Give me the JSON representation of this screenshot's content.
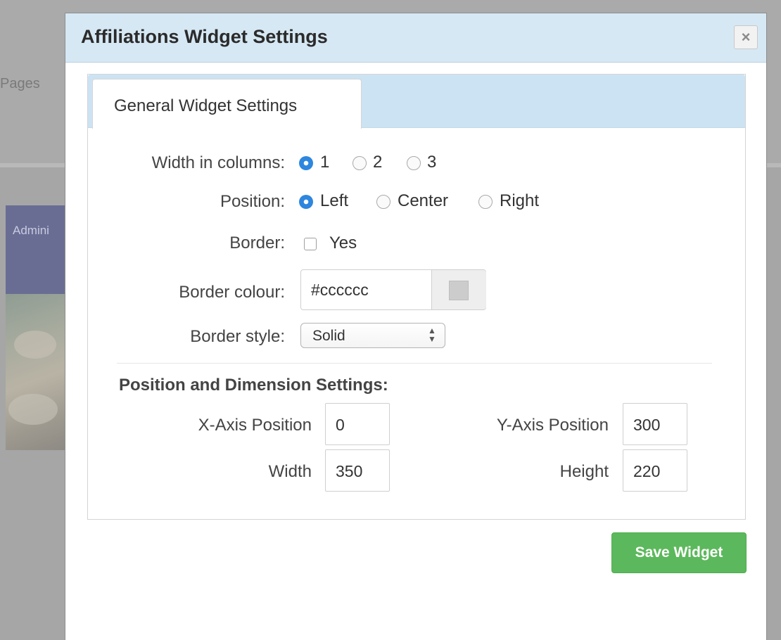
{
  "background": {
    "nav_text": "Pages",
    "admin_text": "Admini"
  },
  "modal": {
    "title": "Affiliations Widget Settings",
    "close_label": "×"
  },
  "tabs": [
    {
      "label": "General Widget Settings",
      "active": true
    }
  ],
  "general": {
    "width_label": "Width in columns:",
    "width_options": [
      "1",
      "2",
      "3"
    ],
    "width_selected": "1",
    "position_label": "Position:",
    "position_options": [
      "Left",
      "Center",
      "Right"
    ],
    "position_selected": "Left",
    "border_label": "Border:",
    "border_option": "Yes",
    "border_checked": false,
    "border_colour_label": "Border colour:",
    "border_colour_value": "#cccccc",
    "border_style_label": "Border style:",
    "border_style_value": "Solid"
  },
  "dimensions": {
    "section_title": "Position and Dimension Settings:",
    "x_label": "X-Axis Position",
    "x_value": "0",
    "y_label": "Y-Axis Position",
    "y_value": "300",
    "width_label": "Width",
    "width_value": "350",
    "height_label": "Height",
    "height_value": "220"
  },
  "footer": {
    "save_label": "Save Widget"
  },
  "colors": {
    "header_bg": "#d6e8f4",
    "tabbar_bg": "#cce3f3",
    "radio_checked": "#2e86de",
    "save_button": "#5cb85c"
  }
}
